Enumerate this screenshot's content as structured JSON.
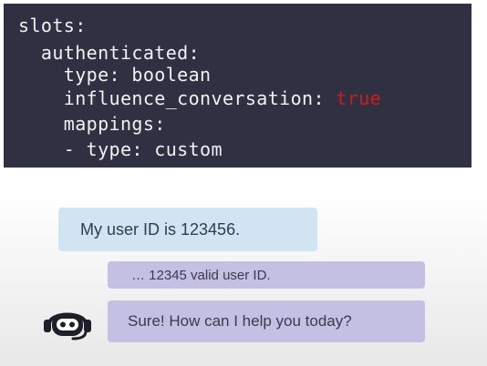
{
  "code": {
    "lines": [
      "slots:",
      "  authenticated:",
      "    type: boolean",
      "    influence_conversation: ",
      "    mappings:",
      "    - type: custom"
    ],
    "true_keyword": "true",
    "colors": {
      "background": "#2f3041",
      "text": "#f2f2f2",
      "keyword_true": "#d11a1a"
    }
  },
  "chat": {
    "user_message": "My user ID is 123456.",
    "system_message": "… 12345 valid user ID.",
    "bot_message": "Sure! How can I help you today?",
    "bot_icon": "robot-headset-icon",
    "colors": {
      "user_bubble": "#d1e4f2",
      "bot_bubble": "#c4c0e4"
    }
  }
}
